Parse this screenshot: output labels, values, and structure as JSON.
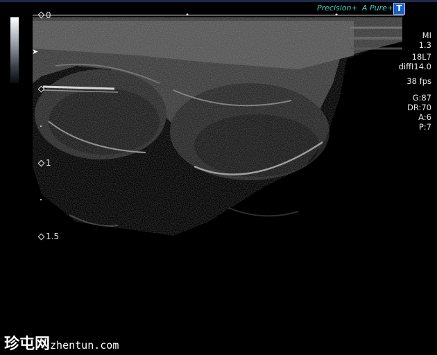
{
  "header": {
    "logo_precision": "Precision+",
    "logo_apure": "A Pure+",
    "probe_button": "T"
  },
  "depth_scale": {
    "labels": [
      "0",
      "1",
      "1.5"
    ]
  },
  "parameters": {
    "mi_label": "MI",
    "mi_value": "1.3",
    "probe": "18L7",
    "mode": "diffI14.0",
    "fps": "38 fps",
    "gain": "G:87",
    "dynamic_range": "DR:70",
    "a_value": "A:6",
    "p_value": "P:7"
  },
  "watermark": {
    "chinese": "珍屯网",
    "domain": "zhentun.com"
  },
  "colors": {
    "logo_accent": "#3fd0c8",
    "probe_button": "#1a5fc9"
  }
}
